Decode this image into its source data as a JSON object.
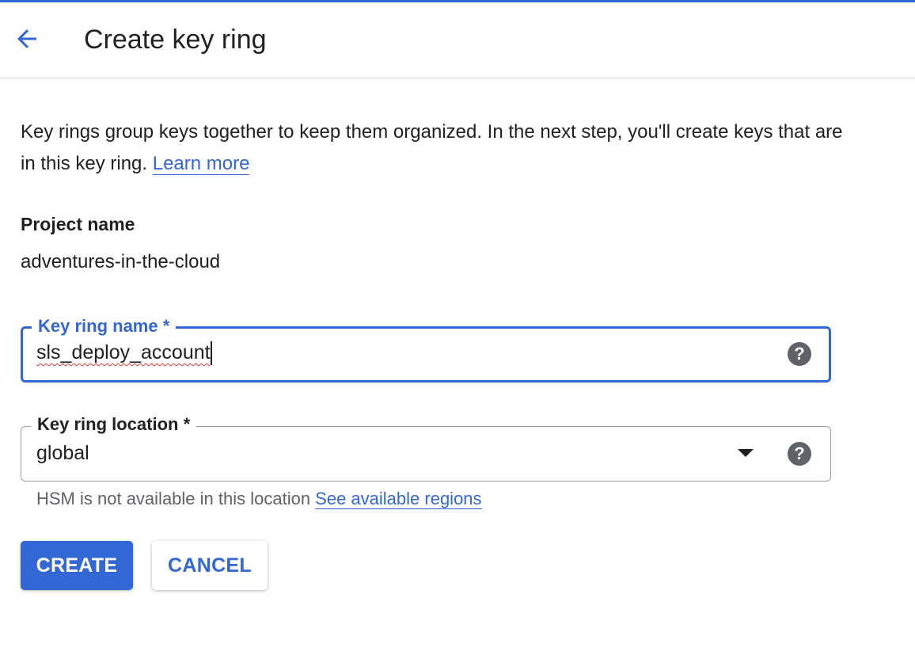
{
  "header": {
    "title": "Create key ring",
    "back_icon": "arrow-back-icon"
  },
  "intro": {
    "text": "Key rings group keys together to keep them organized. In the next step, you'll create keys that are in this key ring. ",
    "link_label": "Learn more"
  },
  "project": {
    "label": "Project name",
    "value": "adventures-in-the-cloud"
  },
  "key_ring_name": {
    "label": "Key ring name *",
    "value": "sls_deploy_account",
    "help_icon": "help-icon",
    "help_glyph": "?"
  },
  "key_ring_location": {
    "label": "Key ring location *",
    "selected": "global",
    "help_glyph": "?",
    "hint_text": "HSM is not available in this location ",
    "hint_link": "See available regions"
  },
  "actions": {
    "create_label": "CREATE",
    "cancel_label": "CANCEL"
  },
  "colors": {
    "accent": "#3367d6",
    "text": "#202124",
    "secondary_text": "#5f6368",
    "divider": "#dadce0"
  }
}
